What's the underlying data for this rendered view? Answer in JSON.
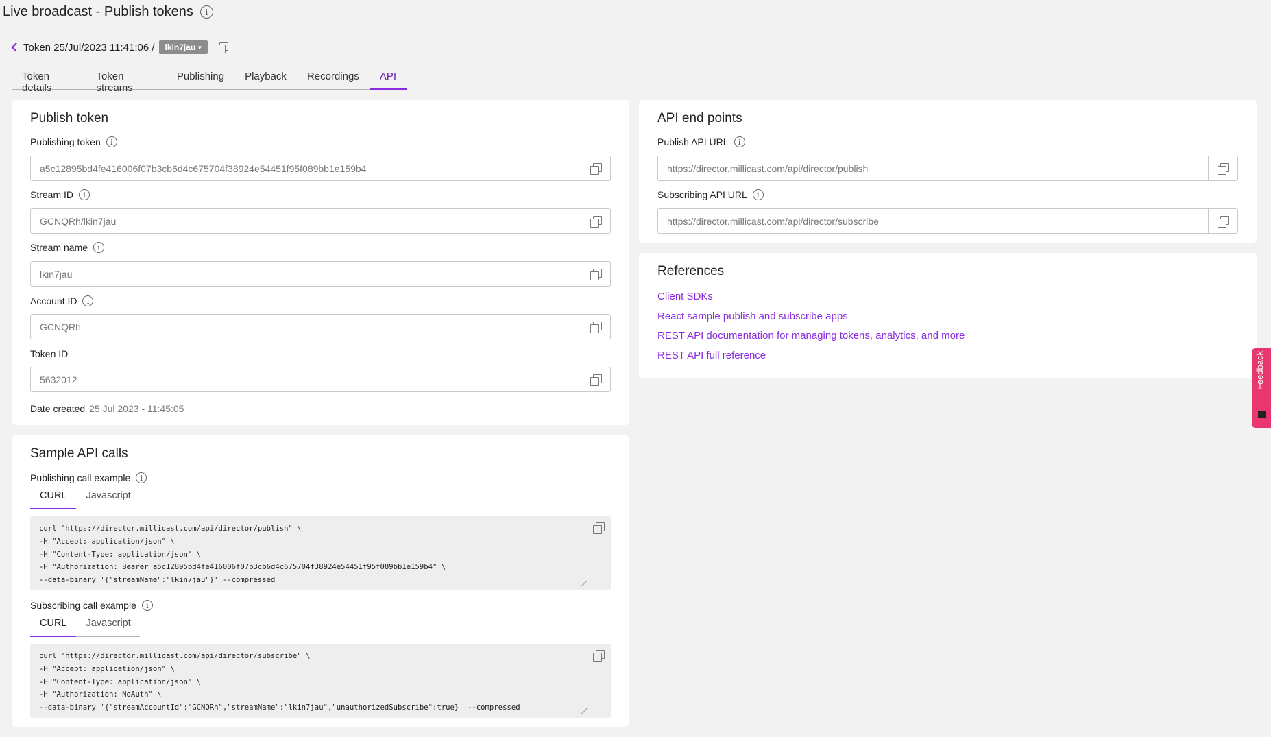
{
  "page": {
    "title": "Live broadcast - Publish tokens"
  },
  "breadcrumb": {
    "token_label": "Token 25/Jul/2023 11:41:06 /",
    "stream_chip": "lkin7jau",
    "chip_caret": "▾"
  },
  "tabs": [
    {
      "label": "Token details",
      "active": false
    },
    {
      "label": "Token streams",
      "active": false
    },
    {
      "label": "Publishing",
      "active": false
    },
    {
      "label": "Playback",
      "active": false
    },
    {
      "label": "Recordings",
      "active": false
    },
    {
      "label": "API",
      "active": true
    }
  ],
  "publish_token": {
    "title": "Publish token",
    "fields": [
      {
        "label": "Publishing token",
        "value": "a5c12895bd4fe416006f07b3cb6d4c675704f38924e54451f95f089bb1e159b4",
        "info": true
      },
      {
        "label": "Stream ID",
        "value": "GCNQRh/lkin7jau",
        "info": true
      },
      {
        "label": "Stream name",
        "value": "lkin7jau",
        "info": true
      },
      {
        "label": "Account ID",
        "value": "GCNQRh",
        "info": true
      },
      {
        "label": "Token ID",
        "value": "5632012",
        "info": false
      }
    ],
    "date_created_label": "Date created",
    "date_created_value": "25 Jul 2023 - 11:45:05"
  },
  "api_endpoints": {
    "title": "API end points",
    "fields": [
      {
        "label": "Publish API URL",
        "value": "https://director.millicast.com/api/director/publish"
      },
      {
        "label": "Subscribing API URL",
        "value": "https://director.millicast.com/api/director/subscribe"
      }
    ]
  },
  "references": {
    "title": "References",
    "links": [
      "Client SDKs",
      "React sample publish and subscribe apps",
      "REST API documentation for managing tokens, analytics, and more",
      "REST API full reference"
    ]
  },
  "sample_calls": {
    "title": "Sample API calls",
    "publishing": {
      "label": "Publishing call example",
      "tabs": [
        "CURL",
        "Javascript"
      ],
      "code": "curl \"https://director.millicast.com/api/director/publish\" \\\n-H \"Accept: application/json\" \\\n-H \"Content-Type: application/json\" \\\n-H \"Authorization: Bearer a5c12895bd4fe416006f07b3cb6d4c675704f38924e54451f95f089bb1e159b4\" \\\n--data-binary '{\"streamName\":\"lkin7jau\"}' --compressed"
    },
    "subscribing": {
      "label": "Subscribing call example",
      "tabs": [
        "CURL",
        "Javascript"
      ],
      "code": "curl \"https://director.millicast.com/api/director/subscribe\" \\\n-H \"Accept: application/json\" \\\n-H \"Content-Type: application/json\" \\\n-H \"Authorization: NoAuth\" \\\n--data-binary '{\"streamAccountId\":\"GCNQRh\",\"streamName\":\"lkin7jau\",\"unauthorizedSubscribe\":true}' --compressed"
    }
  },
  "feedback": {
    "label": "Feedback"
  },
  "icons": {
    "info": "info-icon",
    "copy": "copy-icon",
    "back": "chevron-left-icon"
  },
  "colors": {
    "accent": "#8a2be2",
    "feedback": "#e8366f",
    "background": "#f2f2f2"
  }
}
